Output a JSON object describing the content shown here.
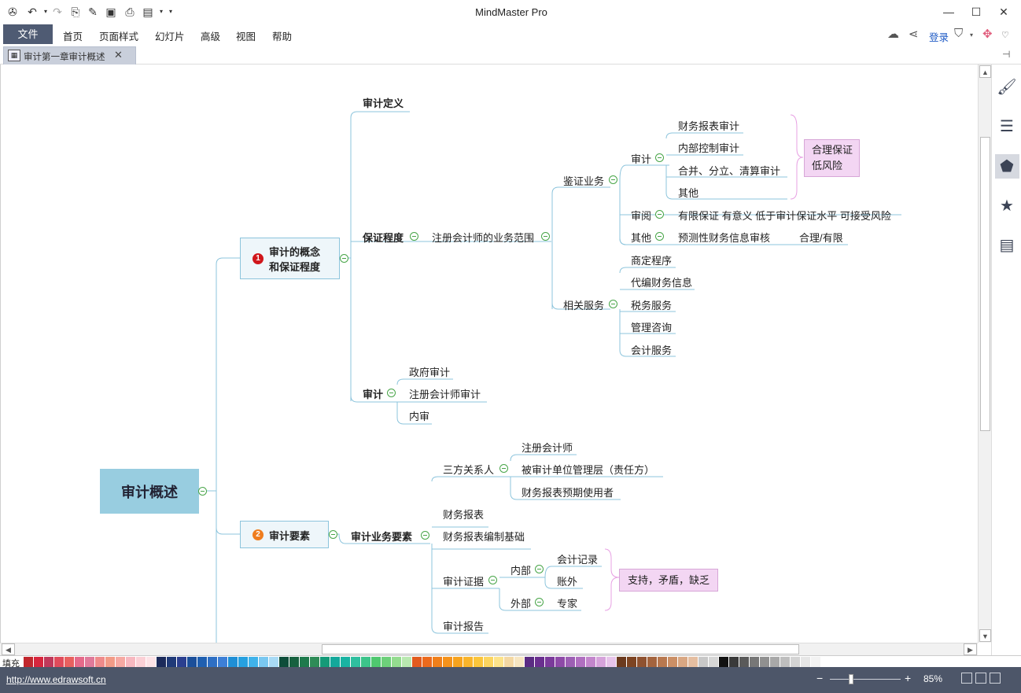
{
  "app": {
    "title": "MindMaster Pro",
    "quick_access": [
      "app-logo-icon",
      "undo-icon",
      "redo-icon",
      "new-icon",
      "open-icon",
      "save-icon",
      "print-icon",
      "export-icon",
      "customize-icon"
    ]
  },
  "menu": {
    "file": "文件",
    "items": [
      "首页",
      "页面样式",
      "幻灯片",
      "高级",
      "视图",
      "帮助"
    ],
    "login": "登录"
  },
  "tab": {
    "label": "审计第一章审计概述",
    "close": "✕"
  },
  "map": {
    "root": "审计概述",
    "branch1": {
      "number": "1",
      "line1": "审计的概念",
      "line2": "和保证程度",
      "children": {
        "definition": "审计定义",
        "assurance": "保证程度",
        "scope": "注册会计师的业务范围",
        "verification": "鉴证业务",
        "audit": "审计",
        "audit_items": [
          "财务报表审计",
          "内部控制审计",
          "合并、分立、清算审计",
          "其他"
        ],
        "audit_note_line1": "合理保证",
        "audit_note_line2": "低风险",
        "review": "审阅",
        "review_desc": "有限保证 有意义 低于审计保证水平 可接受风险",
        "other": "其他",
        "other_desc": "预测性财务信息审核",
        "other_level": "合理/有限",
        "related": "相关服务",
        "related_items": [
          "商定程序",
          "代编财务信息",
          "税务服务",
          "管理咨询",
          "会计服务"
        ],
        "audit_types": "审计",
        "audit_type_items": [
          "政府审计",
          "注册会计师审计",
          "内审"
        ]
      }
    },
    "branch2": {
      "number": "2",
      "label": "审计要素",
      "elements": "审计业务要素",
      "parties": "三方关系人",
      "party_items": [
        "注册会计师",
        "被审计单位管理层（责任方）",
        "财务报表预期使用者"
      ],
      "statements": "财务报表",
      "criteria": "财务报表编制基础",
      "evidence": "审计证据",
      "internal": "内部",
      "internal_items": [
        "会计记录",
        "账外"
      ],
      "external": "外部",
      "external_items": [
        "专家"
      ],
      "evidence_note": "支持，矛盾，缺乏",
      "report": "审计报告"
    }
  },
  "palette_label": "填充",
  "palette_colors": [
    "#c1272d",
    "#d7263d",
    "#c0395a",
    "#e04b5b",
    "#e8605f",
    "#e56a8a",
    "#e07a9a",
    "#ef8b8b",
    "#f29b87",
    "#f6a9a3",
    "#f7b8c0",
    "#fbd0d6",
    "#fde3e7",
    "#1c2a5a",
    "#203a78",
    "#2b3f8f",
    "#1b4f9a",
    "#1f5fb0",
    "#2e6fc4",
    "#3d7fd6",
    "#1f8fd6",
    "#26a0e0",
    "#3fb2ea",
    "#79c7f0",
    "#a8daf5",
    "#0e4d3a",
    "#17613f",
    "#1f7a4c",
    "#2e8b57",
    "#159a78",
    "#14a89b",
    "#19b3a2",
    "#2fbf9f",
    "#3cc48a",
    "#4fc86f",
    "#6dd07a",
    "#94dc8f",
    "#b9e8b0",
    "#e25b1f",
    "#ec6a1d",
    "#f07f1a",
    "#f5921b",
    "#f7a31e",
    "#f9b42b",
    "#fbc53b",
    "#fcd560",
    "#fde38a",
    "#f4d8a3",
    "#f7e6c2",
    "#5b2c83",
    "#6a2f8f",
    "#7b3a9b",
    "#8e4aa8",
    "#9d5fb4",
    "#b06fc0",
    "#c386cc",
    "#d6a3db",
    "#e7c4ea",
    "#6b3a1e",
    "#7d4422",
    "#8f5230",
    "#a4643e",
    "#b8784f",
    "#cb8f66",
    "#d9a783",
    "#e5bea1",
    "#c8c8c8",
    "#d6d6d6",
    "#111111",
    "#3a3a3a",
    "#5a5a5a",
    "#777777",
    "#909090",
    "#a8a8a8",
    "#bebebe",
    "#d4d4d4",
    "#e6e6e6",
    "#f3f3f3"
  ],
  "status": {
    "site": "http://www.edrawsoft.cn",
    "zoom": "85%",
    "zoom_fraction": 0.3
  },
  "colors": {
    "accent": "#4f5b73",
    "line": "#8cc4dc",
    "branch1_number": "#d0161b",
    "branch2_number": "#ef7d1f",
    "note_fill": "#f3d6f3",
    "root_fill": "#98cde0"
  }
}
